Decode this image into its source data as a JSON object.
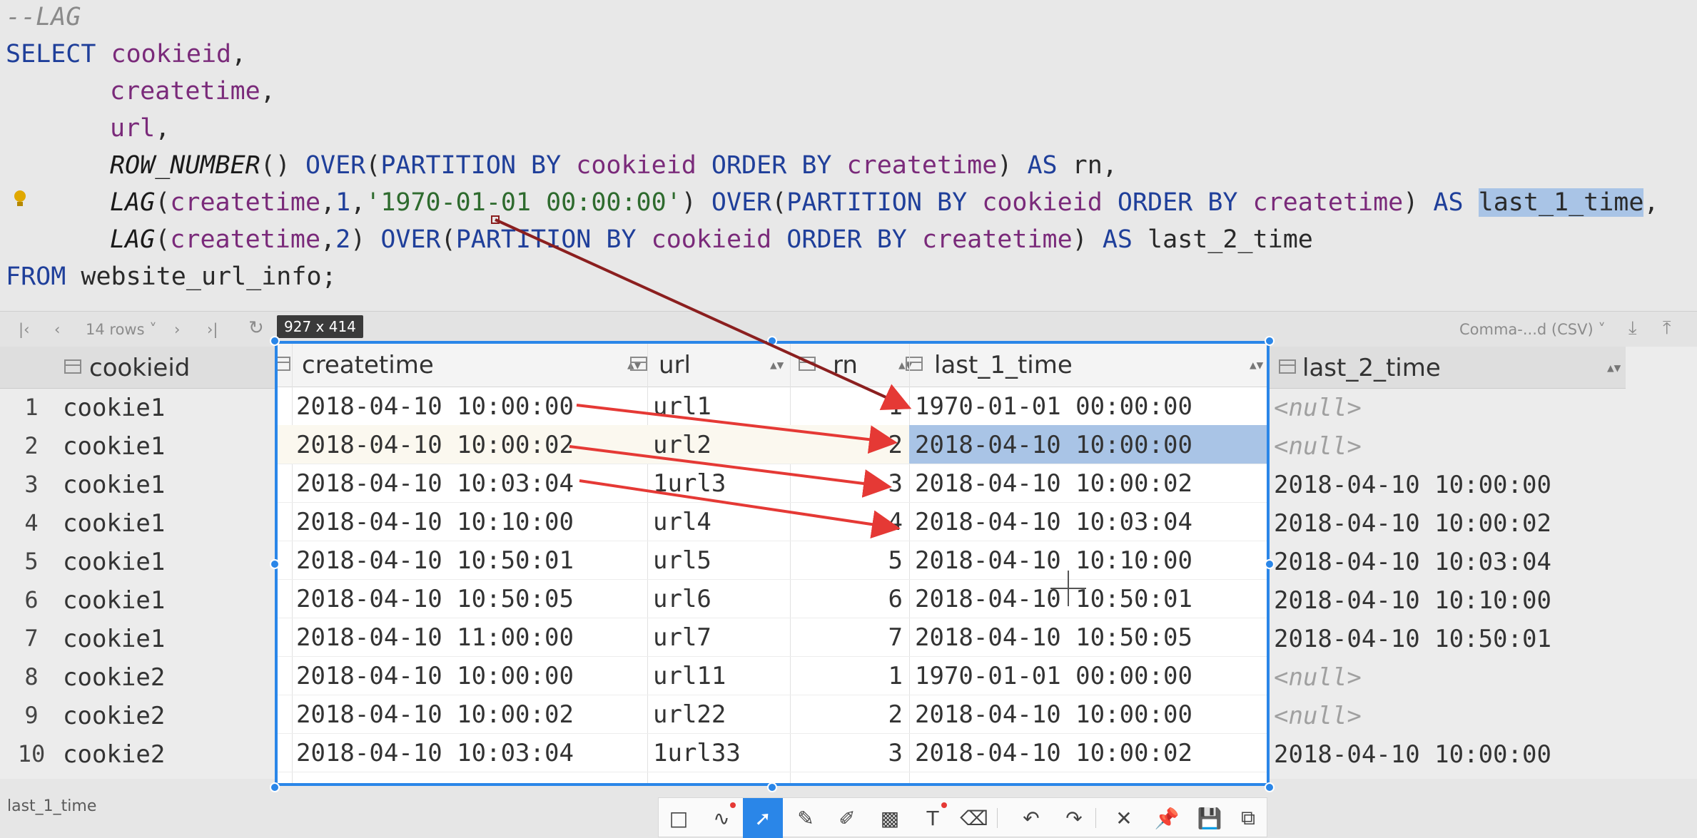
{
  "editor": {
    "comment": "--LAG",
    "lines": [
      [
        "SELECT",
        "cookieid",
        ","
      ],
      [
        "createtime",
        ","
      ],
      [
        "url",
        ","
      ],
      [
        "ROW_NUMBER",
        "() ",
        "OVER",
        "(",
        "PARTITION BY",
        " cookieid ",
        "ORDER BY",
        " createtime",
        ") ",
        "AS",
        " rn,"
      ],
      [
        "LAG",
        "(",
        "createtime",
        ",",
        "1",
        ",",
        "'1970-01-01 00:00:00'",
        ") ",
        "OVER",
        "(",
        "PARTITION BY",
        " cookieid ",
        "ORDER BY",
        " createtime",
        ") ",
        "AS",
        " ",
        "last_1_time",
        ","
      ],
      [
        "LAG",
        "(",
        "createtime",
        ",",
        "2",
        ") ",
        "OVER",
        "(",
        "PARTITION BY",
        " cookieid ",
        "ORDER BY",
        " createtime",
        ") ",
        "AS",
        " last_2_time"
      ],
      [
        "FROM",
        " website_url_info;"
      ]
    ]
  },
  "toolbar": {
    "rows_label": "14 rows",
    "export_format": "Comma-...d (CSV)"
  },
  "capture": {
    "size_label": "927 x 414"
  },
  "grid": {
    "columns": [
      "cookieid",
      "createtime",
      "url",
      "rn",
      "last_1_time",
      "last_2_time"
    ],
    "null_text": "<null>",
    "rows": [
      {
        "n": "1",
        "cookieid": "cookie1",
        "createtime": "2018-04-10 10:00:00",
        "url": "url1",
        "rn": "1",
        "last_1_time": "1970-01-01 00:00:00",
        "last_2_time": null
      },
      {
        "n": "2",
        "cookieid": "cookie1",
        "createtime": "2018-04-10 10:00:02",
        "url": "url2",
        "rn": "2",
        "last_1_time": "2018-04-10 10:00:00",
        "last_2_time": null
      },
      {
        "n": "3",
        "cookieid": "cookie1",
        "createtime": "2018-04-10 10:03:04",
        "url": "1url3",
        "rn": "3",
        "last_1_time": "2018-04-10 10:00:02",
        "last_2_time": "2018-04-10 10:00:00"
      },
      {
        "n": "4",
        "cookieid": "cookie1",
        "createtime": "2018-04-10 10:10:00",
        "url": "url4",
        "rn": "4",
        "last_1_time": "2018-04-10 10:03:04",
        "last_2_time": "2018-04-10 10:00:02"
      },
      {
        "n": "5",
        "cookieid": "cookie1",
        "createtime": "2018-04-10 10:50:01",
        "url": "url5",
        "rn": "5",
        "last_1_time": "2018-04-10 10:10:00",
        "last_2_time": "2018-04-10 10:03:04"
      },
      {
        "n": "6",
        "cookieid": "cookie1",
        "createtime": "2018-04-10 10:50:05",
        "url": "url6",
        "rn": "6",
        "last_1_time": "2018-04-10 10:50:01",
        "last_2_time": "2018-04-10 10:10:00"
      },
      {
        "n": "7",
        "cookieid": "cookie1",
        "createtime": "2018-04-10 11:00:00",
        "url": "url7",
        "rn": "7",
        "last_1_time": "2018-04-10 10:50:05",
        "last_2_time": "2018-04-10 10:50:01"
      },
      {
        "n": "8",
        "cookieid": "cookie2",
        "createtime": "2018-04-10 10:00:00",
        "url": "url11",
        "rn": "1",
        "last_1_time": "1970-01-01 00:00:00",
        "last_2_time": null
      },
      {
        "n": "9",
        "cookieid": "cookie2",
        "createtime": "2018-04-10 10:00:02",
        "url": "url22",
        "rn": "2",
        "last_1_time": "2018-04-10 10:00:00",
        "last_2_time": null
      },
      {
        "n": "10",
        "cookieid": "cookie2",
        "createtime": "2018-04-10 10:03:04",
        "url": "1url33",
        "rn": "3",
        "last_1_time": "2018-04-10 10:00:02",
        "last_2_time": "2018-04-10 10:00:00"
      }
    ],
    "selected_row_index": 1,
    "selected_column": "last_1_time"
  },
  "status": {
    "text": "last_1_time"
  },
  "annotation_tools": [
    "shape-icon",
    "line-icon",
    "arrow-icon",
    "pencil-icon",
    "marker-icon",
    "mosaic-icon",
    "text-icon",
    "eraser-icon",
    "undo-icon",
    "redo-icon",
    "close-icon",
    "pin-icon",
    "save-icon",
    "copy-icon"
  ],
  "colors": {
    "selection_border": "#2a86e8",
    "arrow": "#e53935",
    "highlight": "#a9c4e6"
  }
}
